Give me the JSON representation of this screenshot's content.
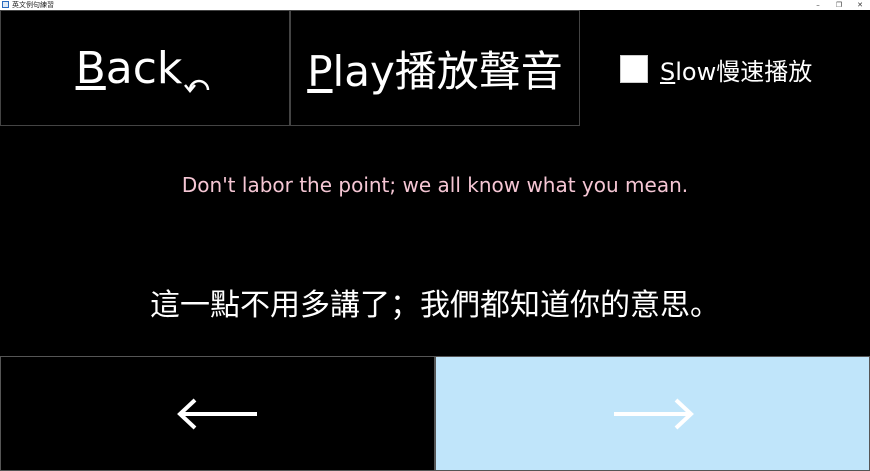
{
  "window": {
    "title": "英文例句練習",
    "minimize_glyph": "–",
    "maximize_glyph": "❐",
    "close_glyph": "✕"
  },
  "toolbar": {
    "back_label": "Back",
    "back_icon": "undo-arrow-icon",
    "play_label": "Play播放聲音",
    "slow_label": "Slow慢速播放",
    "slow_checked": false
  },
  "sentence": {
    "english": "Don't labor the point; we all know what you mean.",
    "chinese": "這一點不用多講了；我們都知道你的意思。",
    "english_color": "#f5c6d4"
  },
  "navigation": {
    "prev_icon": "left-arrow-icon",
    "next_icon": "right-arrow-icon",
    "next_bg_color": "#c0e5fa"
  }
}
